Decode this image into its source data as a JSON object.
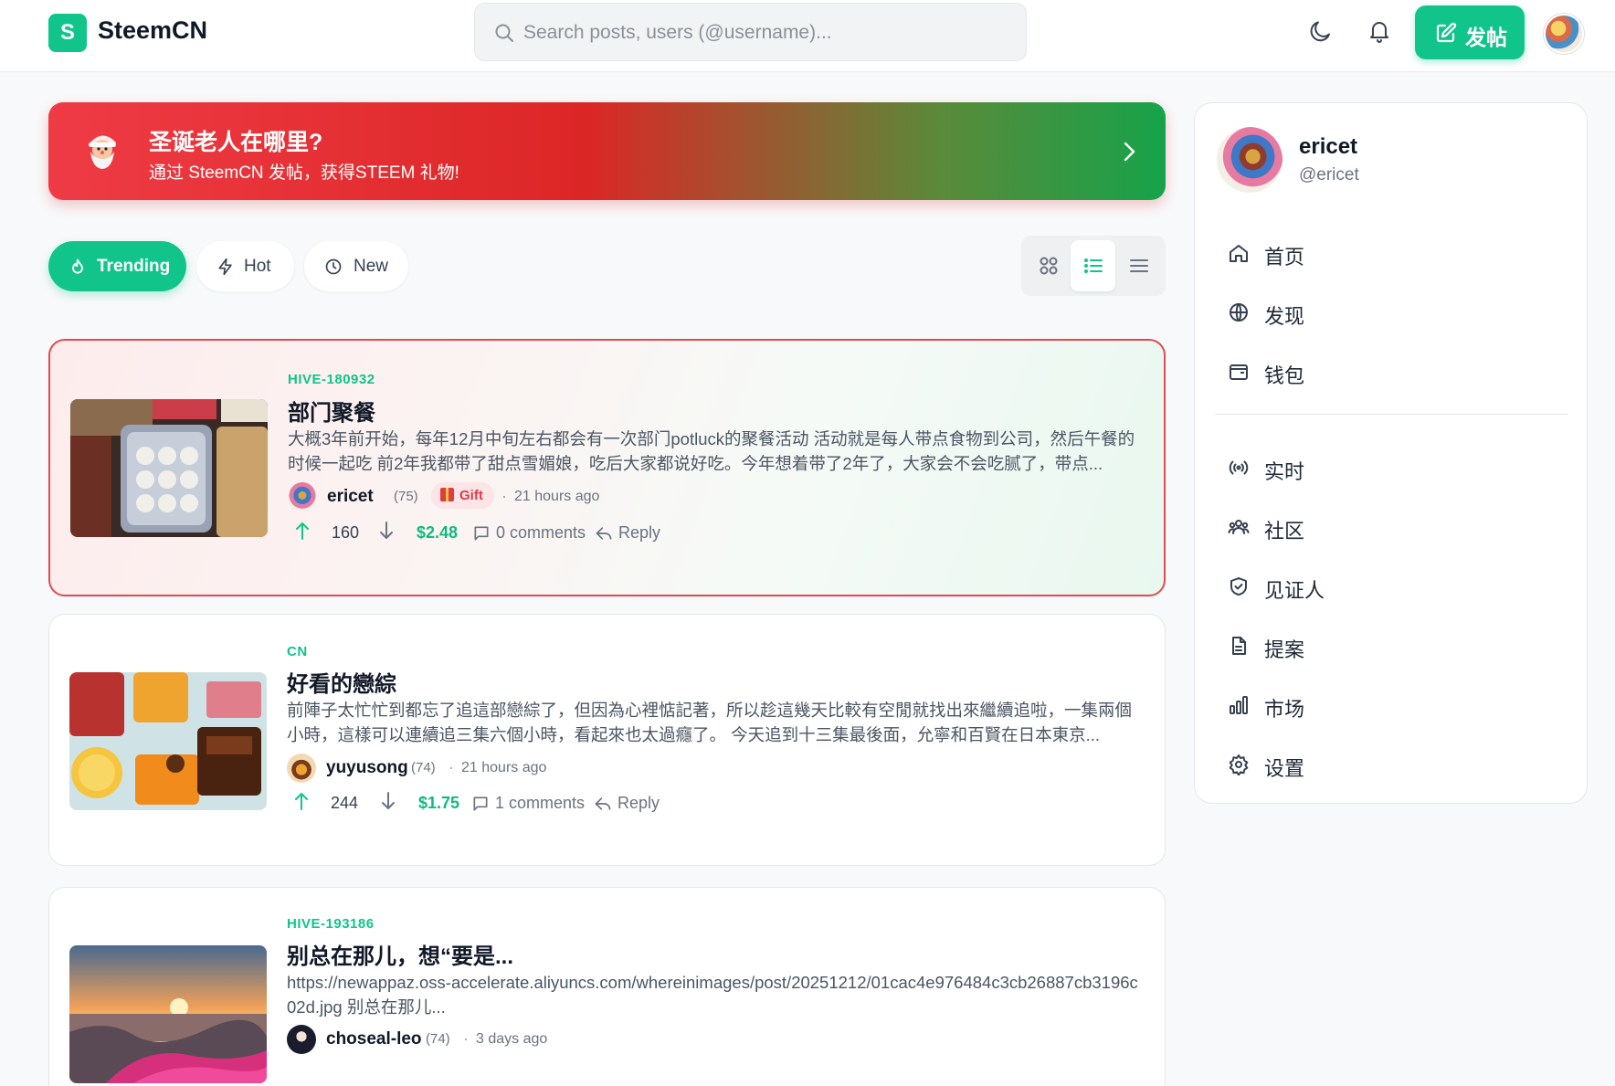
{
  "header": {
    "logo_letter": "S",
    "logo_name": "SteemCN",
    "search_placeholder": "Search posts, users (@username)...",
    "post_button": "发帖",
    "icons": [
      "moon-icon",
      "bell-icon"
    ]
  },
  "banner": {
    "title": "圣诞老人在哪里?",
    "subtitle": "通过 SteemCN 发帖，获得STEEM 礼物!"
  },
  "tabs": [
    {
      "label": "Trending",
      "icon": "flame-icon",
      "active": true
    },
    {
      "label": "Hot",
      "icon": "bolt-icon",
      "active": false
    },
    {
      "label": "New",
      "icon": "clock-icon",
      "active": false
    }
  ],
  "view_modes": [
    "grid",
    "list",
    "compact"
  ],
  "active_view": "list",
  "posts": [
    {
      "tag": "HIVE-180932",
      "title": "部门聚餐",
      "excerpt": "大概3年前开始，每年12月中旬左右都会有一次部门potluck的聚餐活动 活动就是每人带点食物到公司，然后午餐的时候一起吃 前2年我都带了甜点雪媚娘，吃后大家都说好吃。今年想着带了2年了，大家会不会吃腻了，带点...",
      "author": "ericet",
      "reputation": "(75)",
      "badge": "Gift",
      "time": "21 hours ago",
      "votes": "160",
      "payout": "$2.48",
      "comments": "0 comments",
      "reply": "Reply"
    },
    {
      "tag": "CN",
      "title": "好看的戀綜",
      "excerpt": "前陣子太忙忙到都忘了追這部戀綜了，但因為心裡惦記著，所以趁這幾天比較有空閒就找出來繼續追啦，一集兩個小時，這樣可以連續追三集六個小時，看起來也太過癮了。 今天追到十三集最後面，允寧和百賢在日本東京...",
      "author": "yuyusong",
      "reputation": "(74)",
      "time": "21 hours ago",
      "votes": "244",
      "payout": "$1.75",
      "comments": "1 comments",
      "reply": "Reply"
    },
    {
      "tag": "HIVE-193186",
      "title": "别总在那儿，想“要是...",
      "excerpt": "https://newappaz.oss-accelerate.aliyuncs.com/whereinimages/post/20251212/01cac4e976484c3cb26887cb3196c02d.jpg 别总在那儿...",
      "author": "choseal-leo",
      "reputation": "(74)",
      "time": "3 days ago"
    }
  ],
  "sidebar": {
    "name": "ericet",
    "handle": "@ericet",
    "nav": [
      {
        "label": "首页",
        "icon": "home-icon"
      },
      {
        "label": "发现",
        "icon": "globe-icon"
      },
      {
        "label": "钱包",
        "icon": "wallet-icon"
      }
    ],
    "nav2": [
      {
        "label": "实时",
        "icon": "broadcast-icon"
      },
      {
        "label": "社区",
        "icon": "users-icon"
      },
      {
        "label": "见证人",
        "icon": "shield-check-icon"
      },
      {
        "label": "提案",
        "icon": "file-icon"
      },
      {
        "label": "市场",
        "icon": "bar-chart-icon"
      },
      {
        "label": "设置",
        "icon": "settings-icon"
      }
    ]
  },
  "colors": {
    "accent": "#10c48a",
    "banner_start": "#ef3b45",
    "banner_end": "#16a34a",
    "payout": "#10b981"
  }
}
